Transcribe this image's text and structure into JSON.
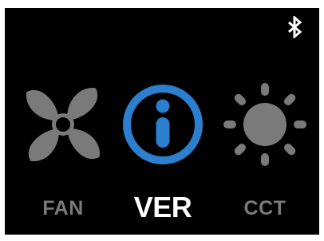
{
  "status_bar": {
    "bluetooth_icon": "bluetooth-icon",
    "bluetooth_color": "#ffffff"
  },
  "menu": {
    "items": [
      {
        "label": "FAN",
        "icon": "fan-icon",
        "selected": false,
        "color": "#7a7a7a"
      },
      {
        "label": "VER",
        "icon": "info-icon",
        "selected": true,
        "color": "#ffffff",
        "icon_color": "#2c7fce"
      },
      {
        "label": "CCT",
        "icon": "sun-icon",
        "selected": false,
        "color": "#7a7a7a"
      }
    ]
  },
  "colors": {
    "background": "#000000",
    "inactive": "#7a7a7a",
    "active_text": "#ffffff",
    "accent": "#2c7fce"
  }
}
